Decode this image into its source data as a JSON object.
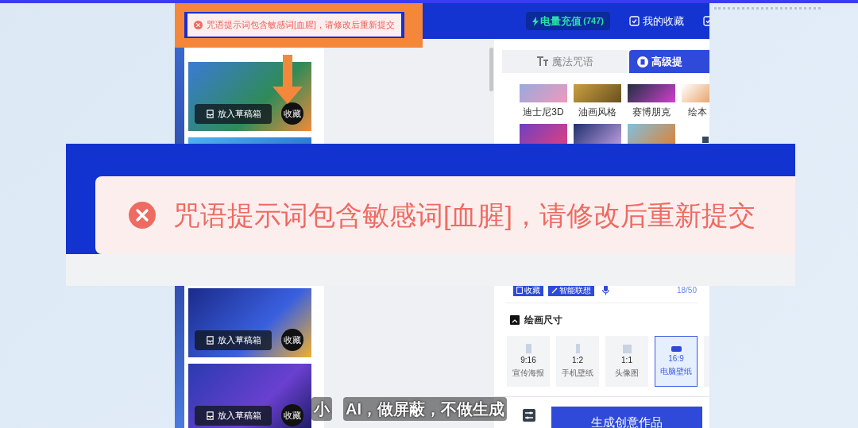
{
  "header": {
    "recharge": {
      "label": "电量充值",
      "count": "(747)"
    },
    "links": [
      "我的收藏"
    ]
  },
  "error_toast": {
    "message": "咒语提示词包含敏感词[血腥]，请修改后重新提交"
  },
  "gallery": {
    "cards": [
      {
        "kind": "full",
        "draft_button": "放入草稿箱",
        "favorite_button": "收藏"
      },
      {
        "kind": "partial"
      },
      {
        "kind": "full",
        "draft_button": "放入草稿箱",
        "favorite_button": "收藏"
      },
      {
        "kind": "full",
        "draft_button": "放入草稿箱",
        "favorite_button": "收藏"
      }
    ]
  },
  "prompt_panel": {
    "tabs": [
      {
        "label": "魔法咒语",
        "selected": false
      },
      {
        "label": "高级提",
        "selected": true
      }
    ],
    "styles": [
      {
        "label": "迪士尼3D"
      },
      {
        "label": "油画风格"
      },
      {
        "label": "赛博朋克"
      },
      {
        "label": "绘本"
      }
    ],
    "toolbar": {
      "buttons": [
        "收藏",
        "智能联想"
      ],
      "counter": "18/50"
    },
    "size_section": {
      "title": "绘画尺寸",
      "options": [
        {
          "kind": "tall",
          "ratio": "9:16",
          "label": "宣传海报",
          "selected": false
        },
        {
          "kind": "narrow",
          "ratio": "1:2",
          "label": "手机壁纸",
          "selected": false
        },
        {
          "kind": "square",
          "ratio": "1:1",
          "label": "头像图",
          "selected": false
        },
        {
          "kind": "wide",
          "ratio": "16:9",
          "label": "电脑壁纸",
          "selected": true
        }
      ]
    },
    "generate_button": "生成创意作品"
  },
  "magnified_toast": {
    "message": "咒语提示词包含敏感词[血腥]，请修改后重新提交"
  },
  "subtitle": {
    "parts": [
      "小",
      "AI，做屏蔽，不做生成"
    ]
  }
}
